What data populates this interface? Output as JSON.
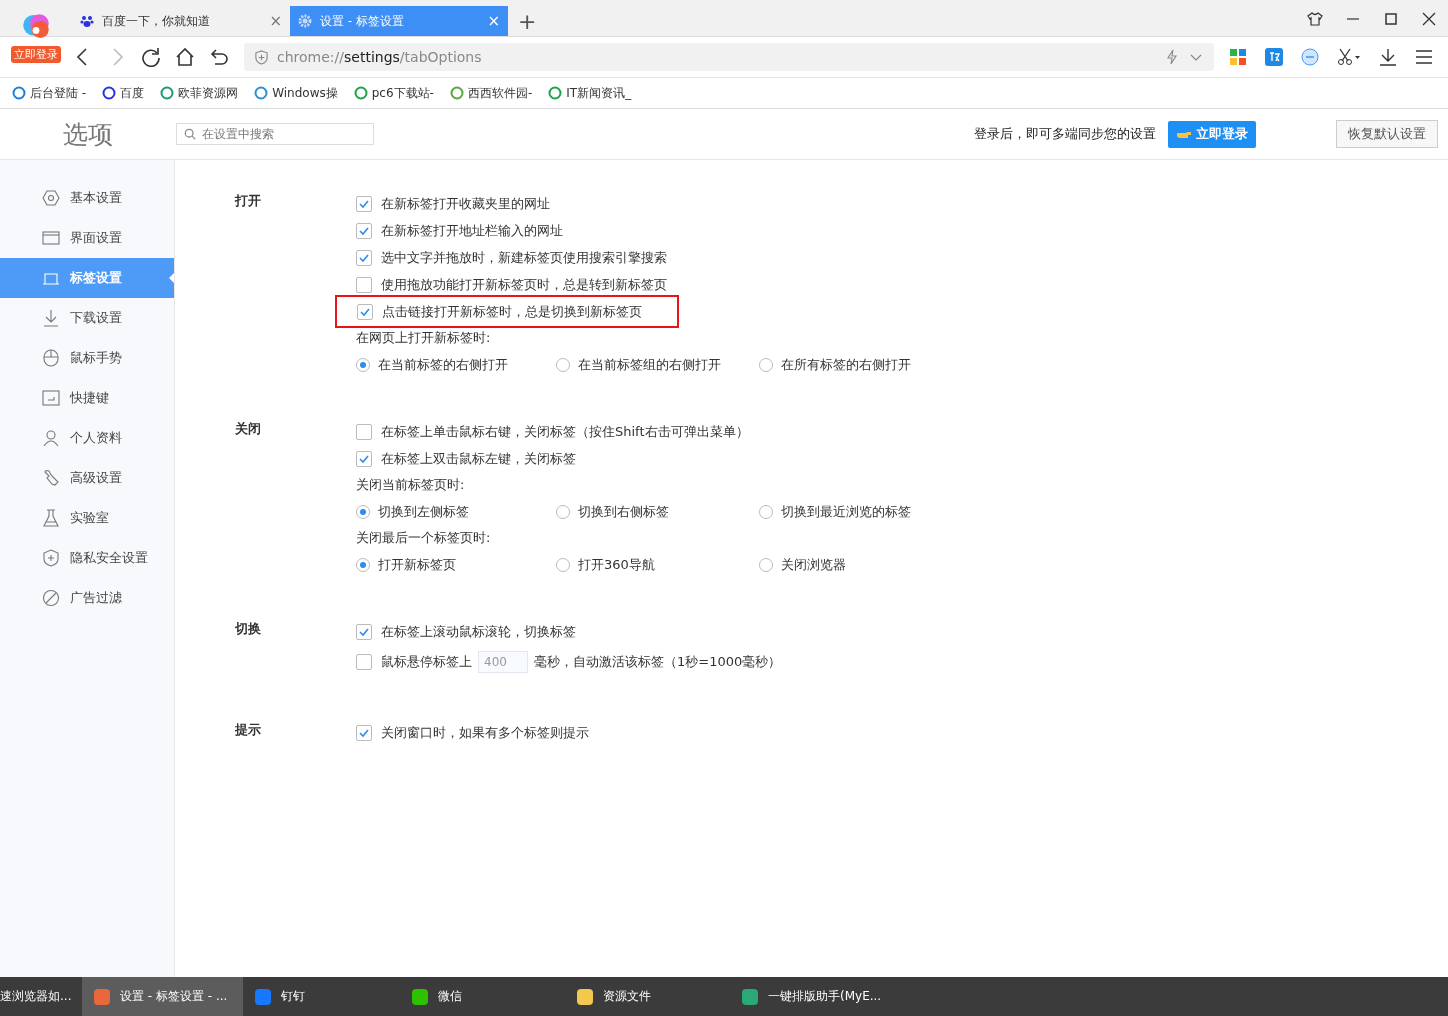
{
  "browser": {
    "login_badge": "立即登录",
    "tabs": [
      {
        "title": "百度一下，你就知道",
        "selected": false,
        "close": "×"
      },
      {
        "title": "设置 - 标签设置",
        "selected": true,
        "close": "×"
      }
    ],
    "new_tab": "+",
    "address": {
      "scheme": "chrome://",
      "host": "settings",
      "path": "/tabOptions"
    },
    "bookmarks": [
      "后台登陆 -",
      "百度",
      "欧菲资源网",
      "Windows操",
      "pc6下载站-",
      "西西软件园-",
      "IT新闻资讯_"
    ]
  },
  "header": {
    "title": "选项",
    "search_placeholder": "在设置中搜索",
    "sync_text": "登录后，即可多端同步您的设置",
    "login_button": "立即登录",
    "reset_button": "恢复默认设置"
  },
  "sidebar": {
    "items": [
      {
        "label": "基本设置",
        "selected": false
      },
      {
        "label": "界面设置",
        "selected": false
      },
      {
        "label": "标签设置",
        "selected": true
      },
      {
        "label": "下载设置",
        "selected": false
      },
      {
        "label": "鼠标手势",
        "selected": false
      },
      {
        "label": "快捷键",
        "selected": false
      },
      {
        "label": "个人资料",
        "selected": false
      },
      {
        "label": "高级设置",
        "selected": false
      },
      {
        "label": "实验室",
        "selected": false
      },
      {
        "label": "隐私安全设置",
        "selected": false
      },
      {
        "label": "广告过滤",
        "selected": false
      }
    ]
  },
  "sections": [
    {
      "title": "打开",
      "rows": [
        {
          "kind": "checkbox",
          "label": "在新标签打开收藏夹里的网址",
          "checked": true,
          "highlighted": false
        },
        {
          "kind": "checkbox",
          "label": "在新标签打开地址栏输入的网址",
          "checked": true,
          "highlighted": false
        },
        {
          "kind": "checkbox",
          "label": "选中文字并拖放时，新建标签页使用搜索引擎搜索",
          "checked": true,
          "highlighted": false
        },
        {
          "kind": "checkbox",
          "label": "使用拖放功能打开新标签页时，总是转到新标签页",
          "checked": false,
          "highlighted": false
        },
        {
          "kind": "checkbox",
          "label": "点击链接打开新标签时，总是切换到新标签页",
          "checked": true,
          "highlighted": true
        },
        {
          "kind": "caption",
          "label": "在网页上打开新标签时:"
        },
        {
          "kind": "radios",
          "options": [
            {
              "label": "在当前标签的右侧打开",
              "selected": true
            },
            {
              "label": "在当前标签组的右侧打开",
              "selected": false
            },
            {
              "label": "在所有标签的右侧打开",
              "selected": false
            }
          ]
        }
      ]
    },
    {
      "title": "关闭",
      "rows": [
        {
          "kind": "checkbox",
          "label": "在标签上单击鼠标右键，关闭标签（按住Shift右击可弹出菜单）",
          "checked": false,
          "highlighted": false
        },
        {
          "kind": "checkbox",
          "label": "在标签上双击鼠标左键，关闭标签",
          "checked": true,
          "highlighted": false
        },
        {
          "kind": "caption",
          "label": "关闭当前标签页时:"
        },
        {
          "kind": "radios",
          "options": [
            {
              "label": "切换到左侧标签",
              "selected": true
            },
            {
              "label": "切换到右侧标签",
              "selected": false
            },
            {
              "label": "切换到最近浏览的标签",
              "selected": false
            }
          ]
        },
        {
          "kind": "caption",
          "label": "关闭最后一个标签页时:"
        },
        {
          "kind": "radios",
          "options": [
            {
              "label": "打开新标签页",
              "selected": true
            },
            {
              "label": "打开360导航",
              "selected": false
            },
            {
              "label": "关闭浏览器",
              "selected": false
            }
          ]
        }
      ]
    },
    {
      "title": "切换",
      "rows": [
        {
          "kind": "checkbox",
          "label": "在标签上滚动鼠标滚轮，切换标签",
          "checked": true,
          "highlighted": false
        },
        {
          "kind": "delay",
          "label": "鼠标悬停标签上",
          "value": "400",
          "suffix": "毫秒，自动激活该标签（1秒=1000毫秒）",
          "checked": false
        }
      ]
    },
    {
      "title": "提示",
      "rows": [
        {
          "kind": "checkbox",
          "label": "关闭窗口时，如果有多个标签则提示",
          "checked": true,
          "highlighted": false
        }
      ]
    }
  ],
  "taskbar": [
    {
      "title": "速浏览器如...",
      "selected": false
    },
    {
      "title": "设置 - 标签设置 - ...",
      "selected": true
    },
    {
      "title": "钉钉",
      "selected": false
    },
    {
      "title": "微信",
      "selected": false
    },
    {
      "title": "资源文件",
      "selected": false
    },
    {
      "title": "一键排版助手(MyE...",
      "selected": false
    }
  ]
}
